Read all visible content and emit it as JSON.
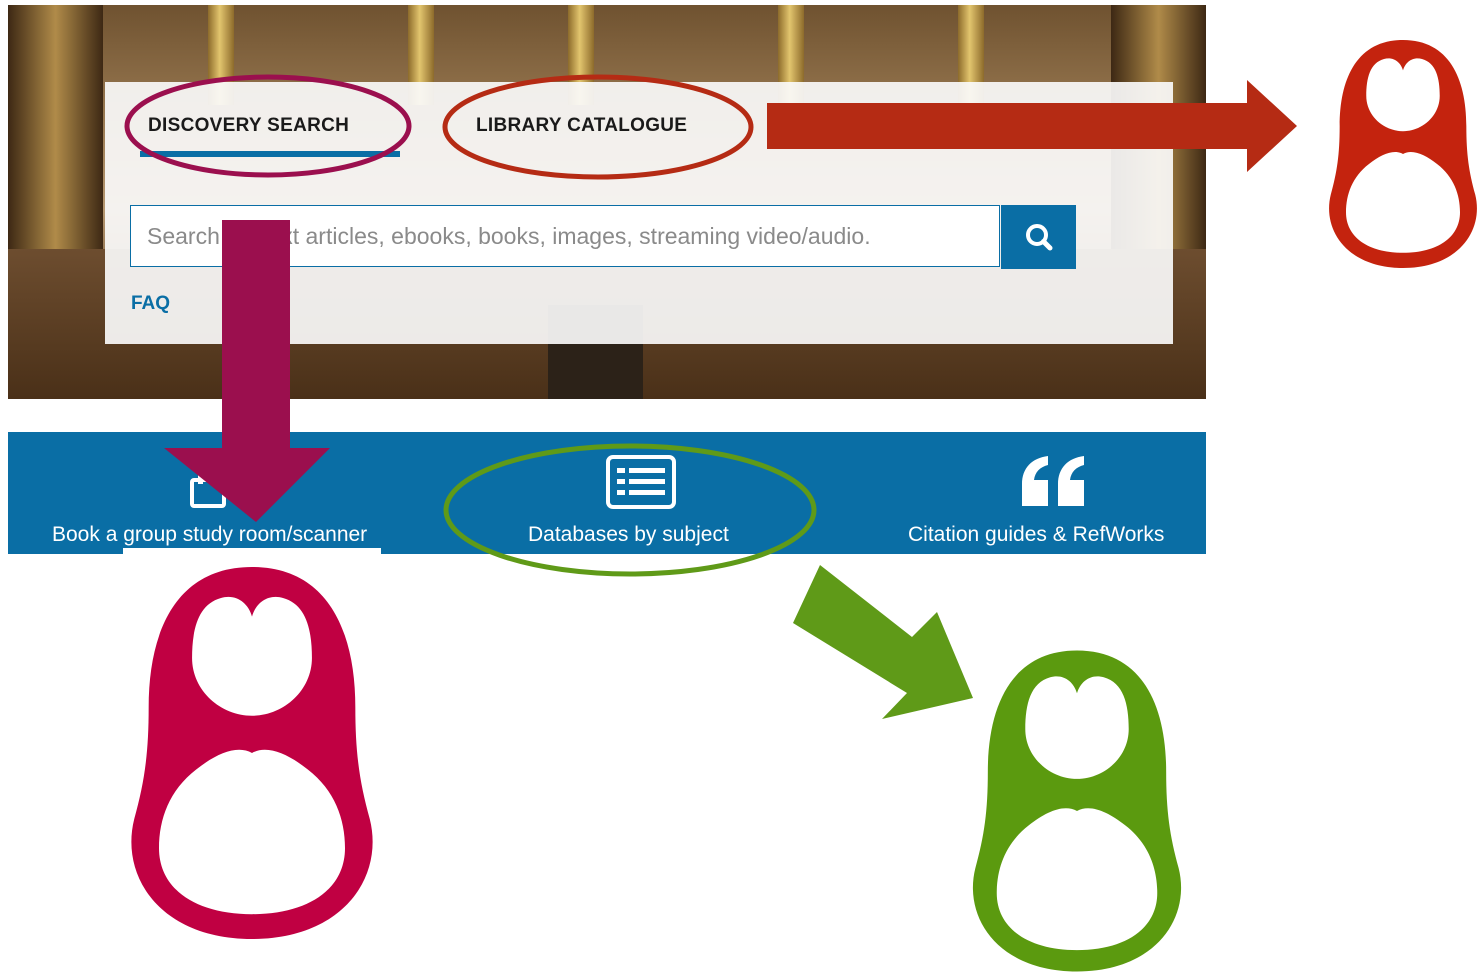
{
  "tabs": {
    "discovery_label": "DISCOVERY SEARCH",
    "catalogue_label": "LIBRARY CATALOGUE"
  },
  "search": {
    "placeholder": "Search full text articles, ebooks, books, images, streaming video/audio."
  },
  "faq_label": "FAQ",
  "quick_links": {
    "book_label": "Book a group study room/scanner",
    "databases_label": "Databases by subject",
    "citation_label": "Citation guides & RefWorks"
  },
  "colors": {
    "brand_blue": "#0a6ea5",
    "annotation_maroon": "#9b0f4e",
    "annotation_red": "#b52b14",
    "annotation_green": "#5f9a18",
    "doll_crimson": "#c00042"
  },
  "icons": {
    "search": "search-icon",
    "book_room": "calendar-icon",
    "databases": "list-icon",
    "citation": "quote-icon",
    "doll": "matryoshka-doll-icon"
  }
}
